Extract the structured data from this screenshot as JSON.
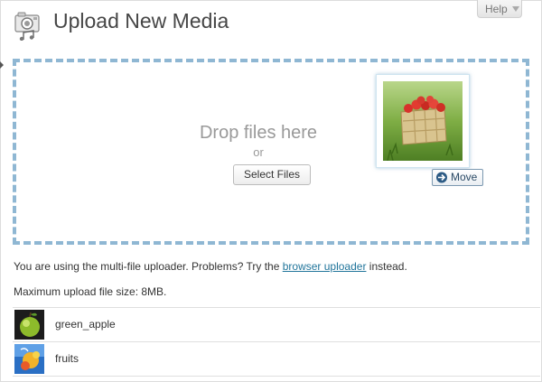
{
  "header": {
    "title": "Upload New Media",
    "help_label": "Help"
  },
  "uploader": {
    "drop_text": "Drop files here",
    "or_text": "or",
    "select_button": "Select Files",
    "move_label": "Move"
  },
  "notice": {
    "prefix": "You are using the multi-file uploader. Problems? Try the ",
    "link_text": "browser uploader",
    "suffix": " instead."
  },
  "max_size_text": "Maximum upload file size: 8MB.",
  "media": {
    "items": [
      {
        "name": "green_apple"
      },
      {
        "name": "fruits"
      }
    ]
  },
  "colors": {
    "dashed_border": "#8fb7d3",
    "link": "#21759b",
    "title": "#464646"
  }
}
